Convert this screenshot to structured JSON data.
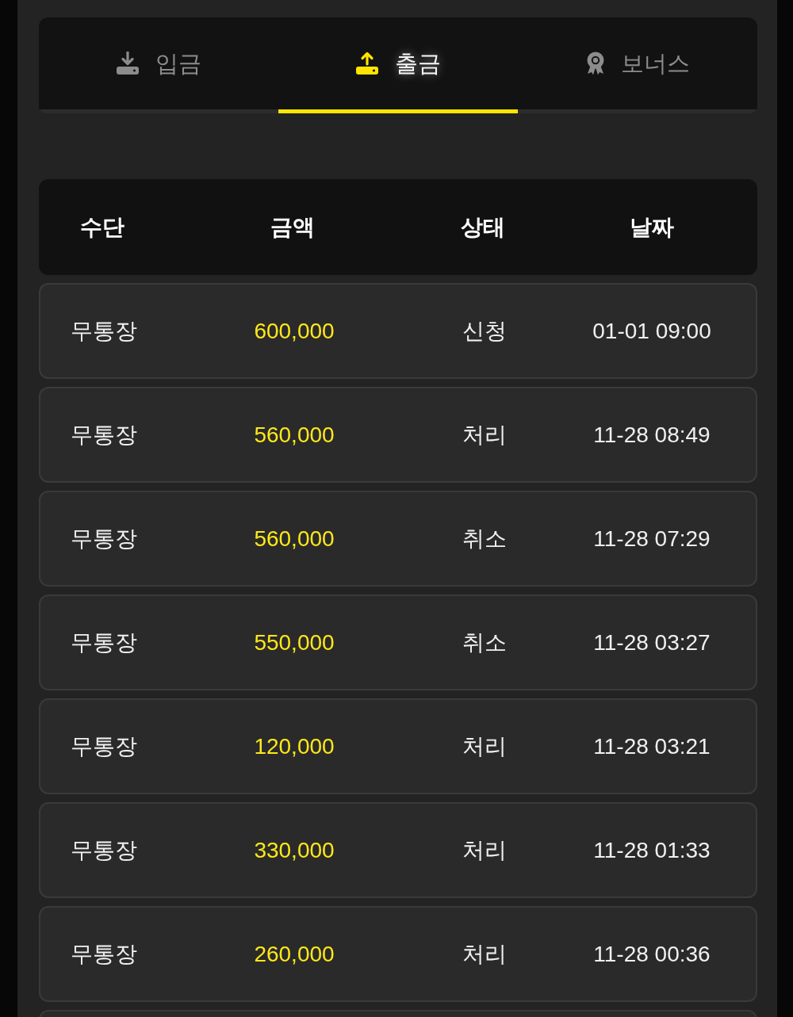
{
  "tabs": [
    {
      "label": "입금",
      "kind": "download",
      "selected": false
    },
    {
      "label": "출금",
      "kind": "upload",
      "selected": true
    },
    {
      "label": "보너스",
      "kind": "award",
      "selected": false
    }
  ],
  "table": {
    "columns": [
      "수단",
      "금액",
      "상태",
      "날짜"
    ],
    "rows": [
      {
        "method": "무통장",
        "amount": "600,000",
        "status": "신청",
        "date": "01-01 09:00"
      },
      {
        "method": "무통장",
        "amount": "560,000",
        "status": "처리",
        "date": "11-28 08:49"
      },
      {
        "method": "무통장",
        "amount": "560,000",
        "status": "취소",
        "date": "11-28 07:29"
      },
      {
        "method": "무통장",
        "amount": "550,000",
        "status": "취소",
        "date": "11-28 03:27"
      },
      {
        "method": "무통장",
        "amount": "120,000",
        "status": "처리",
        "date": "11-28 03:21"
      },
      {
        "method": "무통장",
        "amount": "330,000",
        "status": "처리",
        "date": "11-28 01:33"
      },
      {
        "method": "무통장",
        "amount": "260,000",
        "status": "처리",
        "date": "11-28 00:36"
      }
    ]
  }
}
